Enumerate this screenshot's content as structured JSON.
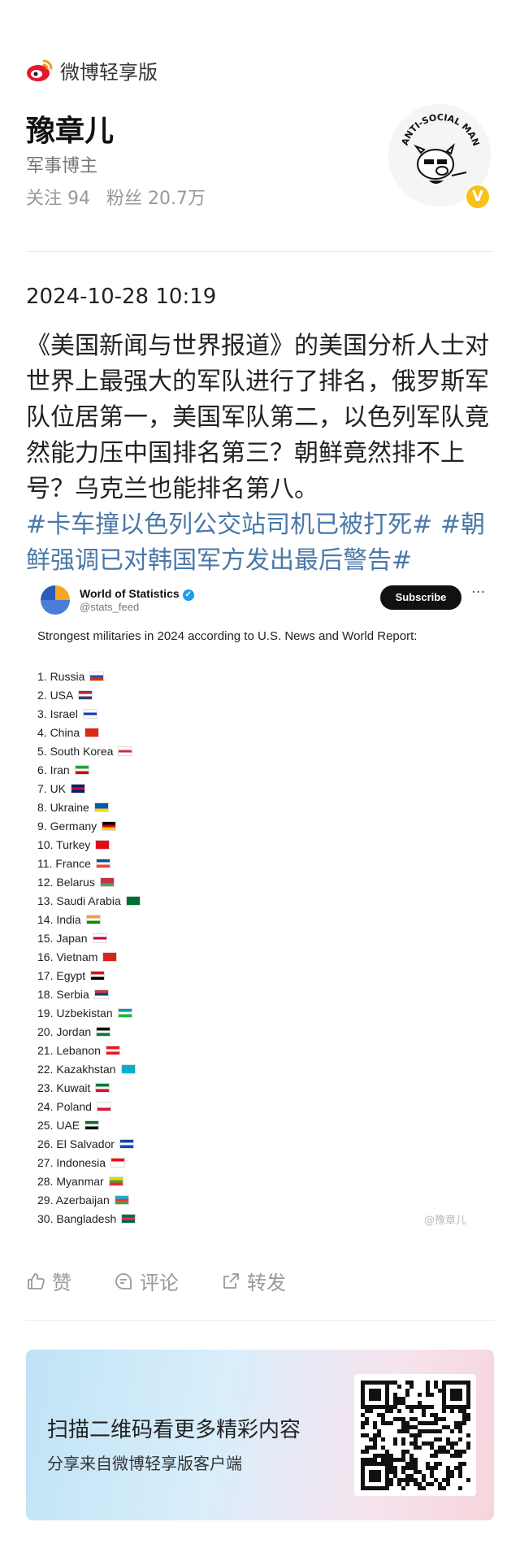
{
  "app": {
    "brand_name": "微博轻享版"
  },
  "profile": {
    "name": "豫章儿",
    "role": "军事博主",
    "following_label": "关注",
    "following_count": "94",
    "followers_label": "粉丝",
    "followers_count": "20.7万"
  },
  "post": {
    "timestamp": "2024-10-28 10:19",
    "body": "《美国新闻与世界报道》的美国分析人士对世界上最强大的军队进行了排名，俄罗斯军队位居第一，美国军队第二，以色列军队竟然能力压中国排名第三？朝鲜竟然排不上号？乌克兰也能排名第八。",
    "hashtag1": "#卡车撞以色列公交站司机已被打死#",
    "hashtag2": "#朝鲜强调已对韩国军方发出最后警告#"
  },
  "embedded": {
    "account_name": "World of Statistics",
    "account_handle": "@stats_feed",
    "subscribe_label": "Subscribe",
    "more_label": "···",
    "title": "Strongest militaries in 2024 according to U.S. News and World Report:",
    "watermark": "@豫章儿",
    "ranking": [
      {
        "text": "1. Russia",
        "flag": [
          "#ffffff",
          "#1f4fb5",
          "#d52b1e"
        ]
      },
      {
        "text": "2. USA",
        "flag": [
          "#b22234",
          "#ffffff",
          "#3c3b6e"
        ]
      },
      {
        "text": "3. Israel",
        "flag": [
          "#ffffff",
          "#0038b8",
          "#ffffff"
        ]
      },
      {
        "text": "4. China",
        "flag": [
          "#de2910",
          "#de2910",
          "#de2910"
        ]
      },
      {
        "text": "5. South Korea",
        "flag": [
          "#ffffff",
          "#cd2e3a",
          "#ffffff"
        ]
      },
      {
        "text": "6. Iran",
        "flag": [
          "#239f40",
          "#ffffff",
          "#da0000"
        ]
      },
      {
        "text": "7. UK",
        "flag": [
          "#012169",
          "#c8102e",
          "#012169"
        ]
      },
      {
        "text": "8. Ukraine",
        "flag": [
          "#0057b7",
          "#0057b7",
          "#ffd700"
        ]
      },
      {
        "text": "9. Germany",
        "flag": [
          "#000000",
          "#dd0000",
          "#ffce00"
        ]
      },
      {
        "text": "10. Turkey",
        "flag": [
          "#e30a17",
          "#e30a17",
          "#e30a17"
        ]
      },
      {
        "text": "11. France",
        "flag": [
          "#0055a4",
          "#ffffff",
          "#ef4135"
        ]
      },
      {
        "text": "12. Belarus",
        "flag": [
          "#c8313e",
          "#c8313e",
          "#4aa657"
        ]
      },
      {
        "text": "13. Saudi Arabia",
        "flag": [
          "#006c35",
          "#006c35",
          "#006c35"
        ]
      },
      {
        "text": "14. India",
        "flag": [
          "#ff9933",
          "#ffffff",
          "#138808"
        ]
      },
      {
        "text": "15. Japan",
        "flag": [
          "#ffffff",
          "#bc002d",
          "#ffffff"
        ]
      },
      {
        "text": "16. Vietnam",
        "flag": [
          "#da251d",
          "#da251d",
          "#da251d"
        ]
      },
      {
        "text": "17. Egypt",
        "flag": [
          "#ce1126",
          "#ffffff",
          "#000000"
        ]
      },
      {
        "text": "18. Serbia",
        "flag": [
          "#c6363c",
          "#0c4076",
          "#ffffff"
        ]
      },
      {
        "text": "19. Uzbekistan",
        "flag": [
          "#0099b5",
          "#ffffff",
          "#1eb53a"
        ]
      },
      {
        "text": "20. Jordan",
        "flag": [
          "#000000",
          "#ffffff",
          "#007a3d"
        ]
      },
      {
        "text": "21. Lebanon",
        "flag": [
          "#ee161f",
          "#ffffff",
          "#ee161f"
        ]
      },
      {
        "text": "22. Kazakhstan",
        "flag": [
          "#00afca",
          "#00afca",
          "#00afca"
        ]
      },
      {
        "text": "23. Kuwait",
        "flag": [
          "#007a3d",
          "#ffffff",
          "#ce1126"
        ]
      },
      {
        "text": "24. Poland",
        "flag": [
          "#ffffff",
          "#ffffff",
          "#dc143c"
        ]
      },
      {
        "text": "25. UAE",
        "flag": [
          "#00732f",
          "#ffffff",
          "#000000"
        ]
      },
      {
        "text": "26. El Salvador",
        "flag": [
          "#0f47af",
          "#ffffff",
          "#0f47af"
        ]
      },
      {
        "text": "27. Indonesia",
        "flag": [
          "#ff0000",
          "#ffffff",
          "#ffffff"
        ]
      },
      {
        "text": "28. Myanmar",
        "flag": [
          "#fecb00",
          "#34b233",
          "#ea2839"
        ]
      },
      {
        "text": "29. Azerbaijan",
        "flag": [
          "#00b5e2",
          "#ef3340",
          "#509e2f"
        ]
      },
      {
        "text": "30. Bangladesh",
        "flag": [
          "#006a4e",
          "#f42a41",
          "#006a4e"
        ]
      }
    ]
  },
  "actions": {
    "like_label": "赞",
    "comment_label": "评论",
    "repost_label": "转发"
  },
  "banner": {
    "title": "扫描二维码看更多精彩内容",
    "subtitle": "分享来自微博轻享版客户端"
  },
  "colors": {
    "hashtag": "#4a78a8",
    "brand_red": "#e6162d",
    "verified_gold": "#f7c21a"
  }
}
